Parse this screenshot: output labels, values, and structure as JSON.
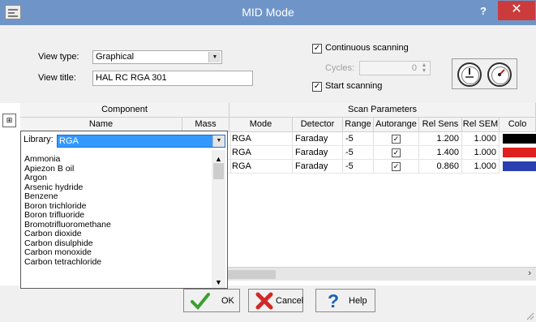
{
  "window": {
    "title": "MID Mode",
    "help_glyph": "?",
    "close_glyph": "✕"
  },
  "form": {
    "view_type_label": "View type:",
    "view_type_value": "Graphical",
    "view_title_label": "View title:",
    "view_title_value": "HAL RC RGA 301",
    "continuous_scanning_label": "Continuous scanning",
    "continuous_scanning_checked": true,
    "cycles_label": "Cycles:",
    "cycles_value": "0",
    "start_scanning_label": "Start scanning",
    "start_scanning_checked": true
  },
  "grid": {
    "group_headers": [
      "Component",
      "Scan Parameters"
    ],
    "columns": [
      "Name",
      "Mass",
      "Mode",
      "Detector",
      "Range",
      "Autorange",
      "Rel Sens",
      "Rel SEM",
      "Colo"
    ],
    "rows": [
      {
        "mode": "RGA",
        "detector": "Faraday",
        "range": "-5",
        "autorange": true,
        "rel_sens": "1.200",
        "rel_sem": "1.000",
        "color": "#000000"
      },
      {
        "mode": "RGA",
        "detector": "Faraday",
        "range": "-5",
        "autorange": true,
        "rel_sens": "1.400",
        "rel_sem": "1.000",
        "color": "#e0201e"
      },
      {
        "mode": "RGA",
        "detector": "Faraday",
        "range": "-5",
        "autorange": true,
        "rel_sens": "0.860",
        "rel_sem": "1.000",
        "color": "#2a3fb0"
      }
    ],
    "row_prefix_glyph": ")"
  },
  "library": {
    "label": "Library:",
    "value": "RGA",
    "items": [
      "Ammonia",
      "Apiezon B oil",
      "Argon",
      "Arsenic hydride",
      "Benzene",
      "Boron trichloride",
      "Boron trifluoride",
      "Bromotrifluoromethane",
      "Carbon dioxide",
      "Carbon disulphide",
      "Carbon monoxide",
      "Carbon tetrachloride"
    ]
  },
  "buttons": {
    "ok": "OK",
    "cancel": "Cancel",
    "help": "Help"
  },
  "colors": {
    "titlebar": "#6f95c8",
    "close": "#cc3b3b",
    "selection": "#3399ff"
  }
}
